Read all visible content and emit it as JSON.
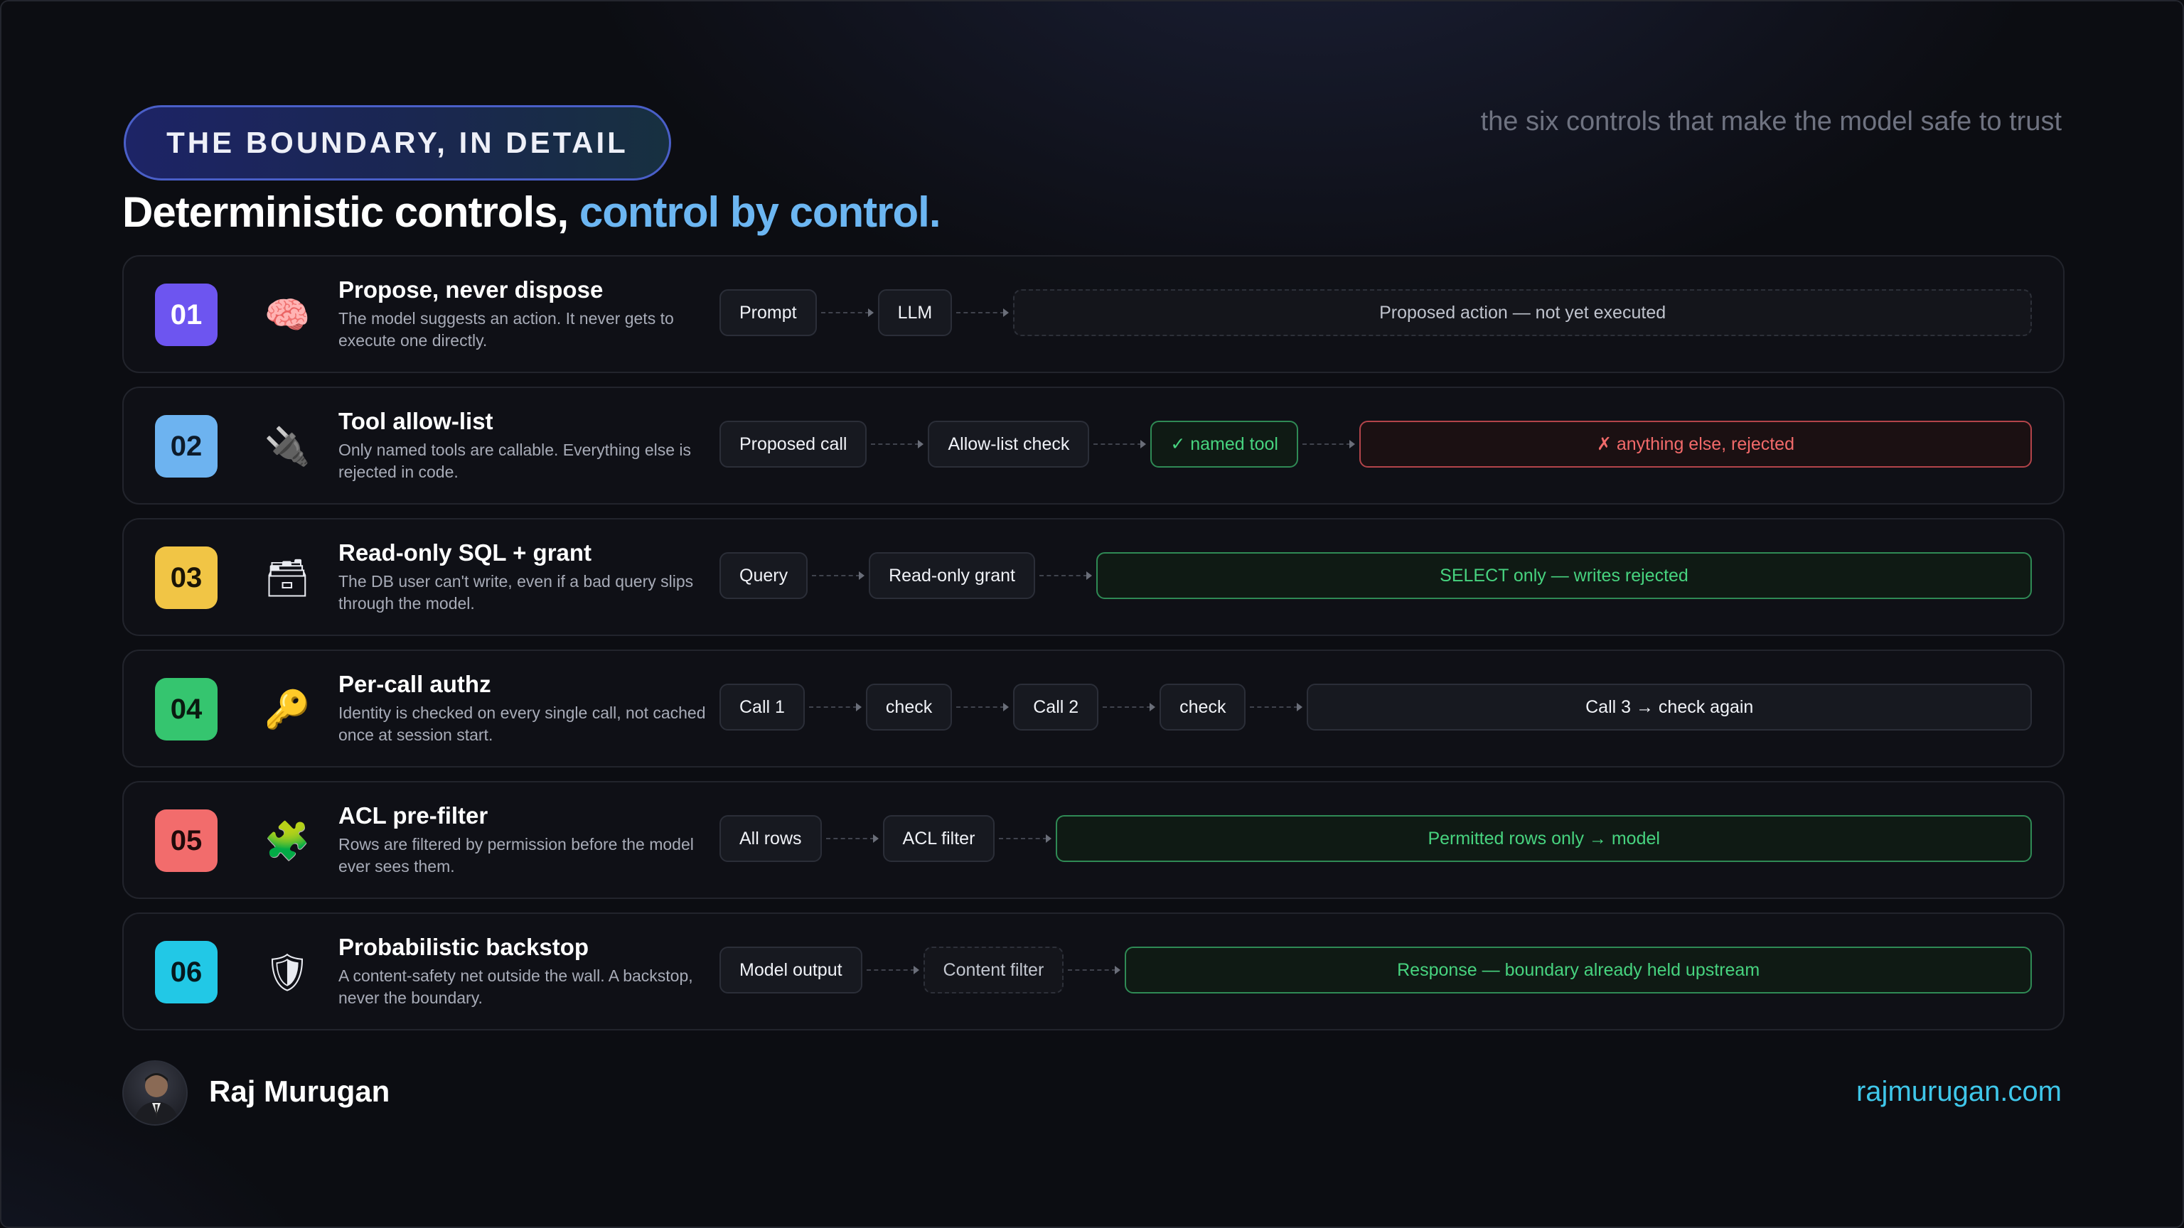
{
  "header": {
    "pill_label": "THE BOUNDARY, IN DETAIL",
    "tagline": "the six controls that make the model safe to trust",
    "headline_main": "Deterministic controls,",
    "headline_accent": "control by control."
  },
  "colors": {
    "accent_blue": "#6cb6f2",
    "ok_green": "#47d37f",
    "reject_red": "#f26a6a",
    "site_cyan": "#3fc7ea"
  },
  "controls": [
    {
      "number": "01",
      "badge_color": "#6d55f0",
      "icon": "brain-icon",
      "glyph": "🧠",
      "title": "Propose, never dispose",
      "description": "The model suggests an action. It never gets to execute one directly.",
      "steps": [
        "Prompt",
        "LLM"
      ],
      "outcome": "Proposed action — not yet executed"
    },
    {
      "number": "02",
      "badge_color": "#6db3f0",
      "icon": "plug-icon",
      "glyph": "🔌",
      "title": "Tool allow-list",
      "description": "Only named tools are callable. Everything else is rejected in code.",
      "steps": [
        "Proposed call",
        "Allow-list check"
      ],
      "allowed": "✓ named tool",
      "outcome": "✗ anything else, rejected"
    },
    {
      "number": "03",
      "badge_color": "#f1c545",
      "icon": "card-file-box-icon",
      "glyph": "🗃",
      "title": "Read-only SQL + grant",
      "description": "The DB user can't write, even if a bad query slips through the model.",
      "steps": [
        "Query",
        "Read-only grant"
      ],
      "outcome": "SELECT only — writes rejected"
    },
    {
      "number": "04",
      "badge_color": "#35c56f",
      "icon": "key-icon",
      "glyph": "🔑",
      "title": "Per-call authz",
      "description": "Identity is checked on every single call, not cached once at session start.",
      "steps": [
        "Call 1",
        "check",
        "Call 2",
        "check"
      ],
      "outcome": "Call 3 → check again"
    },
    {
      "number": "05",
      "badge_color": "#f26c6c",
      "icon": "puzzle-piece-icon",
      "glyph": "🧩",
      "title": "ACL pre-filter",
      "description": "Rows are filtered by permission before the model ever sees them.",
      "steps": [
        "All rows",
        "ACL filter"
      ],
      "outcome": "Permitted rows only → model"
    },
    {
      "number": "06",
      "badge_color": "#22c8e6",
      "icon": "shield-icon",
      "glyph": "🛡",
      "title": "Probabilistic backstop",
      "description": "A content-safety net outside the wall. A backstop, never the boundary.",
      "steps": [
        "Model output",
        "Content filter"
      ],
      "outcome": "Response — boundary already held upstream"
    }
  ],
  "footer": {
    "author": "Raj Murugan",
    "site": "rajmurugan.com"
  }
}
